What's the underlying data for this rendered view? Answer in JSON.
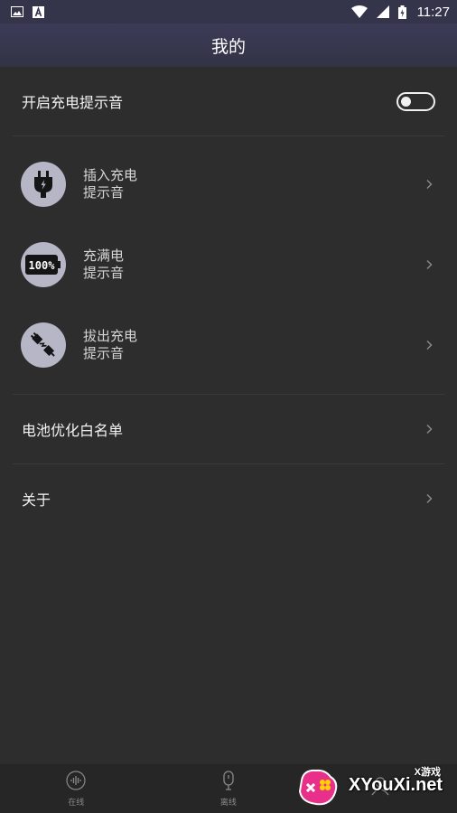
{
  "status_bar": {
    "time": "11:27",
    "left_icons": [
      "image-icon",
      "a-box-icon"
    ],
    "right_icons": [
      "wifi-icon",
      "signal-icon",
      "battery-icon"
    ]
  },
  "header": {
    "title": "我的"
  },
  "settings": {
    "charge_sound_toggle": {
      "label": "开启充电提示音",
      "enabled": false
    },
    "sound_items": [
      {
        "icon": "plug-icon",
        "line1": "插入充电",
        "line2": "提示音"
      },
      {
        "icon": "battery-full-icon",
        "icon_text": "100%",
        "line1": "充满电",
        "line2": "提示音"
      },
      {
        "icon": "unplug-icon",
        "line1": "拔出充电",
        "line2": "提示音"
      }
    ],
    "battery_whitelist": {
      "label": "电池优化白名单"
    },
    "about": {
      "label": "关于"
    }
  },
  "bottom_nav": {
    "items": [
      {
        "icon": "voice-wave-icon",
        "label": "在线"
      },
      {
        "icon": "microphone-icon",
        "label": "离线"
      },
      {
        "icon": "person-icon",
        "label": ""
      }
    ]
  },
  "watermark": {
    "brand": "XYouXi.net",
    "small": "X游戏"
  },
  "colors": {
    "background": "#2d2d2d",
    "header": "#34344a",
    "icon_circle": "#b6b6c6",
    "bottom_nav": "#262626"
  }
}
